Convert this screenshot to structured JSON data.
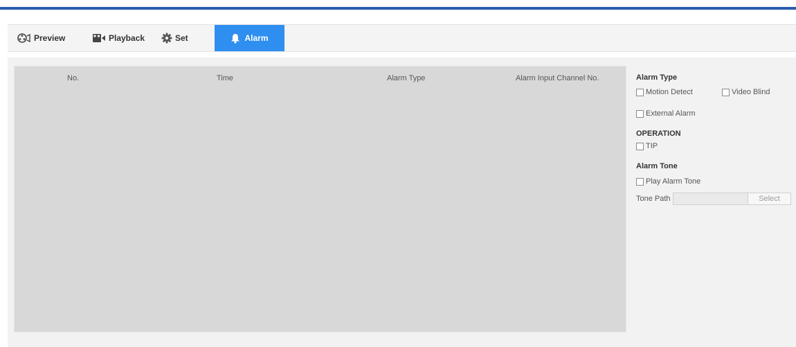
{
  "nav": {
    "tabs": [
      {
        "label": "Preview",
        "icon": "camera-icon"
      },
      {
        "label": "Playback",
        "icon": "video-camera-icon"
      },
      {
        "label": "Set",
        "icon": "gear-icon"
      },
      {
        "label": "Alarm",
        "icon": "bell-icon"
      }
    ],
    "active_tab": "Alarm"
  },
  "table": {
    "columns": [
      "No.",
      "Time",
      "Alarm Type",
      "Alarm Input Channel No."
    ],
    "rows": []
  },
  "sidebar": {
    "alarm_type": {
      "title": "Alarm Type",
      "options": [
        {
          "label": "Motion Detect",
          "checked": false
        },
        {
          "label": "Video Blind",
          "checked": false
        },
        {
          "label": "External Alarm",
          "checked": false
        }
      ]
    },
    "operation": {
      "title": "OPERATION",
      "options": [
        {
          "label": "TIP",
          "checked": false
        }
      ]
    },
    "alarm_tone": {
      "title": "Alarm Tone",
      "play_label": "Play Alarm Tone",
      "play_checked": false,
      "tone_path_label": "Tone Path",
      "tone_path_value": "",
      "select_label": "Select"
    }
  },
  "colors": {
    "top_bar": "#2a5db0",
    "active_tab": "#2f8ff0",
    "table_bg": "#d8d8d8"
  }
}
